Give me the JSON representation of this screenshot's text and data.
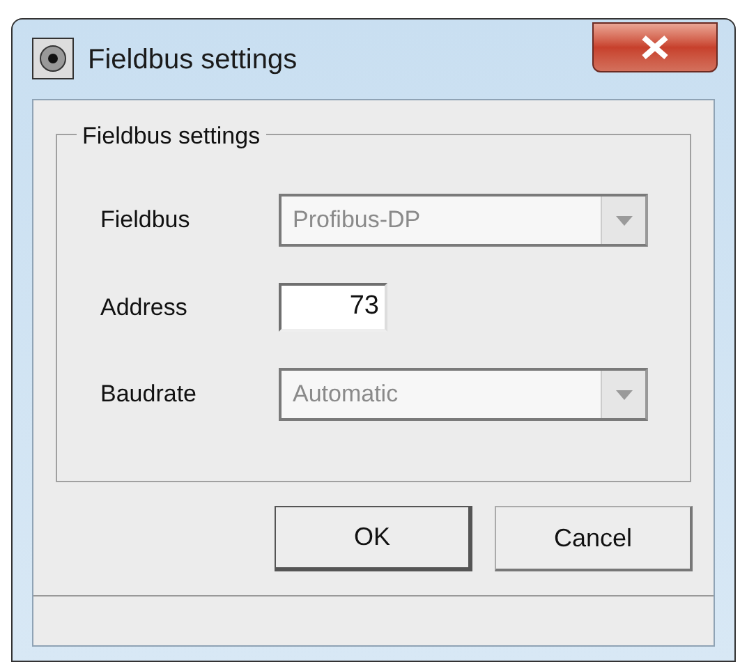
{
  "window": {
    "title": "Fieldbus settings"
  },
  "group": {
    "title": "Fieldbus settings",
    "fields": [
      {
        "kind": "combo",
        "label": "Fieldbus",
        "value": "Profibus-DP",
        "disabled": true
      },
      {
        "kind": "text",
        "label": "Address",
        "value": "73",
        "disabled": false
      },
      {
        "kind": "combo",
        "label": "Baudrate",
        "value": "Automatic",
        "disabled": true
      }
    ]
  },
  "buttons": [
    {
      "label": "OK",
      "default": true
    },
    {
      "label": "Cancel",
      "default": false
    }
  ]
}
